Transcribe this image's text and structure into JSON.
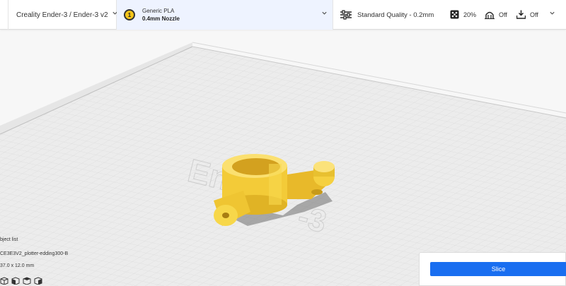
{
  "toolbar": {
    "printer": {
      "label": "Creality Ender-3 / Ender-3 v2",
      "icon": "chevron-down-icon"
    },
    "material": {
      "extruder_number": "1",
      "name": "Generic PLA",
      "nozzle": "0.4mm Nozzle",
      "icon": "chevron-down-icon"
    },
    "print_settings": {
      "quality_label": "Standard Quality - 0.2mm",
      "infill_value": "20%",
      "support_value": "Off",
      "adhesion_value": "Off"
    }
  },
  "object_list": {
    "title": "bject list",
    "object_name": "CE3E3V2_plotter-edding300-B",
    "dimensions": "37.0 x 12.0 mm"
  },
  "slice_panel": {
    "button_label": "Slice"
  },
  "colors": {
    "accent": "#196ef0",
    "model": "#f5d040",
    "material_badge": "#f5c518",
    "material_section_bg": "#eef3ff"
  }
}
